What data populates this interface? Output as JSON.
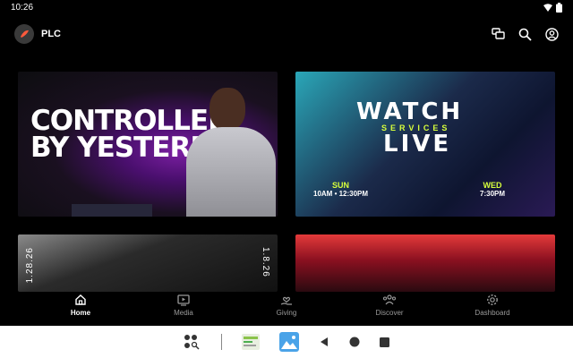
{
  "status_bar": {
    "time": "10:26"
  },
  "header": {
    "brand_name": "PLC"
  },
  "cards": {
    "featured_sermon": {
      "title_line1": "CONTROLLED",
      "title_line2": "BY YESTERDAY"
    },
    "watch_live": {
      "watch_text": "WATCH",
      "services_text": "SERVICES",
      "live_text": "LIVE",
      "sunday_day": "SUN",
      "sunday_times": "10AM • 12:30PM",
      "wednesday_day": "WED",
      "wednesday_time": "7:30PM"
    },
    "series_card": {
      "date_left": "1.28.26",
      "date_right": "1.8.26"
    }
  },
  "bottom_nav": {
    "items": [
      {
        "label": "Home",
        "icon": "home-icon",
        "active": true
      },
      {
        "label": "Media",
        "icon": "media-icon",
        "active": false
      },
      {
        "label": "Giving",
        "icon": "giving-icon",
        "active": false
      },
      {
        "label": "Discover",
        "icon": "discover-icon",
        "active": false
      },
      {
        "label": "Dashboard",
        "icon": "dashboard-icon",
        "active": false
      }
    ]
  },
  "colors": {
    "accent_yellow": "#d7ff3c",
    "background": "#000000",
    "nav_inactive": "#9a9a9a"
  }
}
